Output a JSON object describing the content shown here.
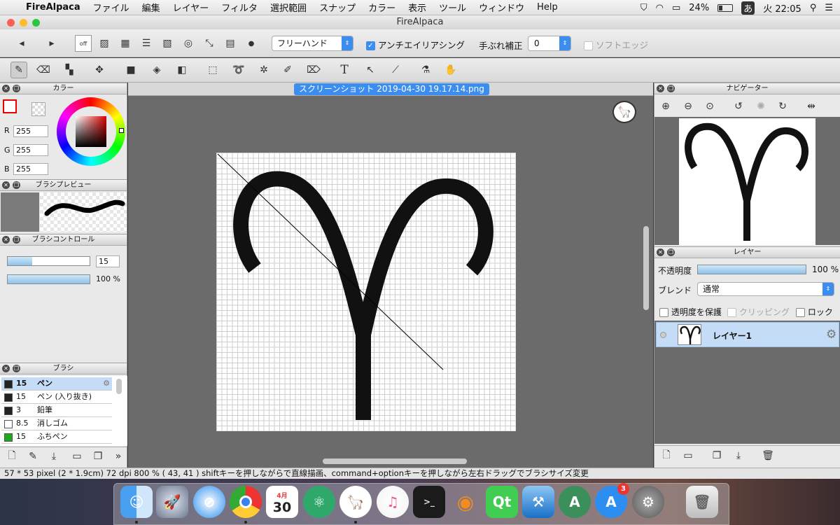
{
  "menubar": {
    "apple": "",
    "items": [
      "FireAlpaca",
      "ファイル",
      "編集",
      "レイヤー",
      "フィルタ",
      "選択範囲",
      "スナップ",
      "カラー",
      "表示",
      "ツール",
      "ウィンドウ",
      "Help"
    ],
    "battery": "24%",
    "input_method": "あ",
    "clock": "火 22:05"
  },
  "window": {
    "title": "FireAlpaca"
  },
  "tool_options": {
    "mode": "フリーハンド",
    "antialias_label": "アンチエイリアシング",
    "stabilizer_label": "手ぶれ補正",
    "stabilizer_value": "0",
    "soft_edge_label": "ソフトエッジ",
    "off_label": "off"
  },
  "color_panel": {
    "title": "カラー",
    "r_label": "R",
    "g_label": "G",
    "b_label": "B",
    "r": "255",
    "g": "255",
    "b": "255"
  },
  "brush_preview": {
    "title": "ブラシプレビュー"
  },
  "brush_control": {
    "title": "ブラシコントロール",
    "size": "15",
    "opacity": "100 %",
    "size_fraction": 0.3,
    "opacity_fraction": 1.0
  },
  "brush_panel": {
    "title": "ブラシ",
    "items": [
      {
        "size": "15",
        "name": "ペン",
        "color": "#222222",
        "selected": true
      },
      {
        "size": "15",
        "name": "ペン (入り抜き)",
        "color": "#222222"
      },
      {
        "size": "3",
        "name": "鉛筆",
        "color": "#222222"
      },
      {
        "size": "8.5",
        "name": "消しゴム",
        "color": "#ffffff"
      },
      {
        "size": "15",
        "name": "ふちペン",
        "color": "#1ea81e"
      }
    ]
  },
  "canvas": {
    "tab": "スクリーンショット 2019-04-30 19.17.14.png"
  },
  "navigator": {
    "title": "ナビゲーター"
  },
  "layers": {
    "title": "レイヤー",
    "opacity_label": "不透明度",
    "opacity_value": "100 %",
    "blend_label": "ブレンド",
    "blend_value": "通常",
    "protect_label": "透明度を保護",
    "clipping_label": "クリッピング",
    "lock_label": "ロック",
    "layer_name": "レイヤー1"
  },
  "status": {
    "text": "57 * 53 pixel   (2 * 1.9cm)   72 dpi   800 %   ( 43, 41 )   shiftキーを押しながらで直線描画、command+optionキーを押しながら左右ドラッグでブラシサイズ変更"
  },
  "dock": {
    "calendar_month": "4月",
    "calendar_day": "30",
    "appstore_badge": "3"
  }
}
